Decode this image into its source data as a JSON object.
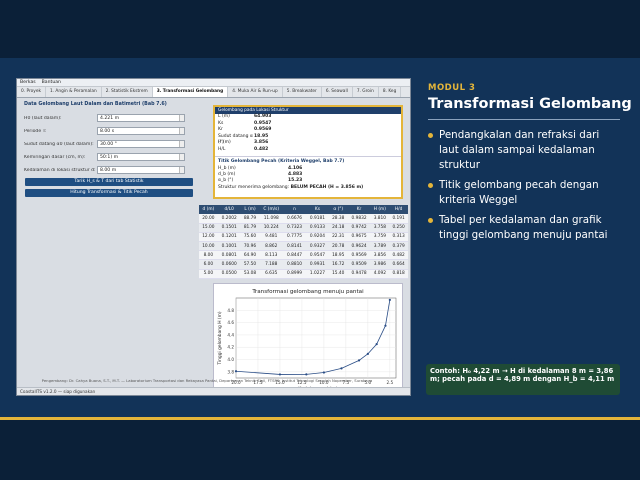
{
  "app": {
    "menu": [
      "Berkas",
      "Bantuan"
    ],
    "tabs": [
      "0. Proyek",
      "1. Angin & Peramalan",
      "2. Statistik Ekstrem",
      "3. Transformasi Gelombang",
      "4. Muka Air & Run-up",
      "5. Breakwater",
      "6. Seawall",
      "7. Groin",
      "8. Keg"
    ],
    "active_tab": 3,
    "left": {
      "title": "Data Gelombang Laut Dalam dan Batimetri (Bab 7.6)",
      "fields": [
        {
          "label": "H0 (laut dalam):",
          "value": "4.221 m"
        },
        {
          "label": "Periode T:",
          "value": "8.00 s"
        },
        {
          "label": "Sudut datang α0 (laut dalam):",
          "value": "30.00 °"
        },
        {
          "label": "Kemiringan dasar (cm, m):",
          "value": "50:1) m"
        },
        {
          "label": "Kedalaman di lokasi struktur d:",
          "value": "8.00 m"
        }
      ],
      "btn1": "Tarik H_s & T dari tab Statistik",
      "btn2": "Hitung Transformasi & Titik Pecah"
    },
    "result": {
      "head": "Gelombang pada Lokasi Struktur",
      "rows": [
        {
          "k": "L (m)",
          "v": "64.903"
        },
        {
          "k": "Ks",
          "v": "0.9547"
        },
        {
          "k": "Kr",
          "v": "0.9569"
        },
        {
          "k": "Sudut datang α (°)",
          "v": "18.95"
        },
        {
          "k": "H (m)",
          "v": "3.856"
        },
        {
          "k": "H/L",
          "v": "0.482"
        }
      ],
      "sub": "Titik Gelombang Pecah (Kriteria Weggel, Bab 7.7)",
      "break_rows": [
        {
          "k": "H_b (m)",
          "v": "4.106"
        },
        {
          "k": "d_b (m)",
          "v": "4.883"
        },
        {
          "k": "α_b (°)",
          "v": "15.23"
        }
      ],
      "status_label": "Struktur menerima gelombang:",
      "status_value": "BELUM PECAH (H = 3.856 m)"
    },
    "table": {
      "headers": [
        "d (m)",
        "d/L0",
        "L (m)",
        "C (m/s)",
        "n",
        "Ks",
        "α (°)",
        "Kr",
        "H (m)",
        "H/d"
      ],
      "rows": [
        [
          "20.00",
          "0.2002",
          "88.79",
          "11.098",
          "0.6676",
          "0.9181",
          "28.38",
          "0.9832",
          "3.810",
          "0.191"
        ],
        [
          "15.00",
          "0.1501",
          "81.79",
          "10.224",
          "0.7323",
          "0.9133",
          "24.18",
          "0.9742",
          "3.758",
          "0.250"
        ],
        [
          "12.00",
          "0.1201",
          "75.60",
          "9.481",
          "0.7775",
          "0.9204",
          "22.31",
          "0.9675",
          "3.759",
          "0.313"
        ],
        [
          "10.00",
          "0.1001",
          "70.96",
          "8.862",
          "0.8141",
          "0.9327",
          "20.78",
          "0.9624",
          "3.789",
          "0.379"
        ],
        [
          "8.00",
          "0.0801",
          "64.90",
          "8.113",
          "0.8447",
          "0.9547",
          "18.95",
          "0.9569",
          "3.856",
          "0.482"
        ],
        [
          "6.00",
          "0.0600",
          "57.50",
          "7.188",
          "0.8810",
          "0.9931",
          "16.72",
          "0.9509",
          "3.986",
          "0.664"
        ],
        [
          "5.00",
          "0.0500",
          "53.08",
          "6.635",
          "0.8999",
          "1.0227",
          "15.40",
          "0.9478",
          "4.092",
          "0.818"
        ]
      ]
    },
    "footer": "Pengembang: Dr. Cahya Buana, S.T., M.T. — Laboratorium Transportasi dan Rekayasa Pantai, Departemen Teknik Sipil, FTSPK, Institut Teknologi Sepuluh Nopember, Surabaya",
    "status": "CoastalITS v1.2.0 — siap digunakan"
  },
  "chart_data": {
    "type": "line",
    "title": "Transformasi gelombang menuju pantai",
    "xlabel": "Kedalaman d (m)",
    "ylabel": "Tinggi gelombang H (m)",
    "x": [
      20,
      15,
      12,
      10,
      8,
      6,
      5,
      4,
      3,
      2.5
    ],
    "y": [
      3.81,
      3.758,
      3.759,
      3.789,
      3.856,
      3.986,
      4.092,
      4.25,
      4.55,
      4.97
    ],
    "xticks": [
      "20.0",
      "17.5",
      "15.0",
      "12.5",
      "10.0",
      "7.5",
      "5.0",
      "2.5"
    ],
    "xlim": [
      20,
      1.8
    ],
    "ylim": [
      3.7,
      5.0
    ],
    "yticks": [
      "3.8",
      "4.0",
      "4.2",
      "4.4",
      "4.6",
      "4.8"
    ],
    "grid": true,
    "color": "#2a4d86"
  },
  "slide": {
    "kicker": "MODUL 3",
    "title": "Transformasi Gelombang",
    "bullets": [
      "Pendangkalan dan refraksi dari laut dalam sampai kedalaman struktur",
      "Titik gelombang pecah dengan kriteria Weggel",
      "Tabel per kedalaman dan grafik tinggi gelombang menuju pantai"
    ],
    "note": "Contoh: H₀ 4,22 m → H di kedalaman 8 m = 3,86 m; pecah pada d = 4,89 m dengan H_b = 4,11 m",
    "accent": "#e4b53a",
    "note_bg": "#1f4b35"
  }
}
